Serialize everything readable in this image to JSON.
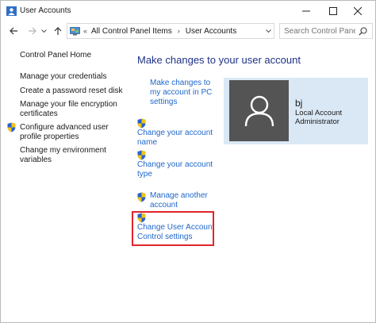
{
  "window": {
    "title": "User Accounts"
  },
  "nav": {
    "overflow": "«",
    "breadcrumbs": [
      "All Control Panel Items",
      "User Accounts"
    ],
    "separator": "›",
    "search_placeholder": "Search Control Panel"
  },
  "sidebar": {
    "items": [
      {
        "label": "Control Panel Home",
        "shield": false
      },
      {
        "label": "Manage your credentials",
        "shield": false
      },
      {
        "label": "Create a password reset disk",
        "shield": false
      },
      {
        "label": "Manage your file encryption",
        "label2": "certificates",
        "shield": false
      },
      {
        "label": "Configure advanced user",
        "label2": "profile properties",
        "shield": true
      },
      {
        "label": "Change my environment",
        "label2": "variables",
        "shield": false
      }
    ]
  },
  "main": {
    "heading": "Make changes to your user account",
    "tasks": [
      {
        "line1": "Make changes to",
        "line2": "my account in PC",
        "line3": "settings",
        "shield": false
      },
      {
        "line1": "Change your account",
        "line2": "name",
        "shield": true
      },
      {
        "line1": "Change your account",
        "line2": "type",
        "shield": true
      },
      {
        "line1": "Manage another",
        "line2": "account",
        "shield": true
      },
      {
        "line1": "Change User Account",
        "line2": "Control settings",
        "shield": true,
        "highlighted": true
      }
    ]
  },
  "user": {
    "name": "bj",
    "account_type": "Local Account",
    "role": "Administrator"
  },
  "colors": {
    "link": "#1e67c9",
    "heading": "#1e3287",
    "user_panel_bg": "#dae8f5",
    "avatar_bg": "#545454",
    "highlight_border": "#e0242b"
  }
}
